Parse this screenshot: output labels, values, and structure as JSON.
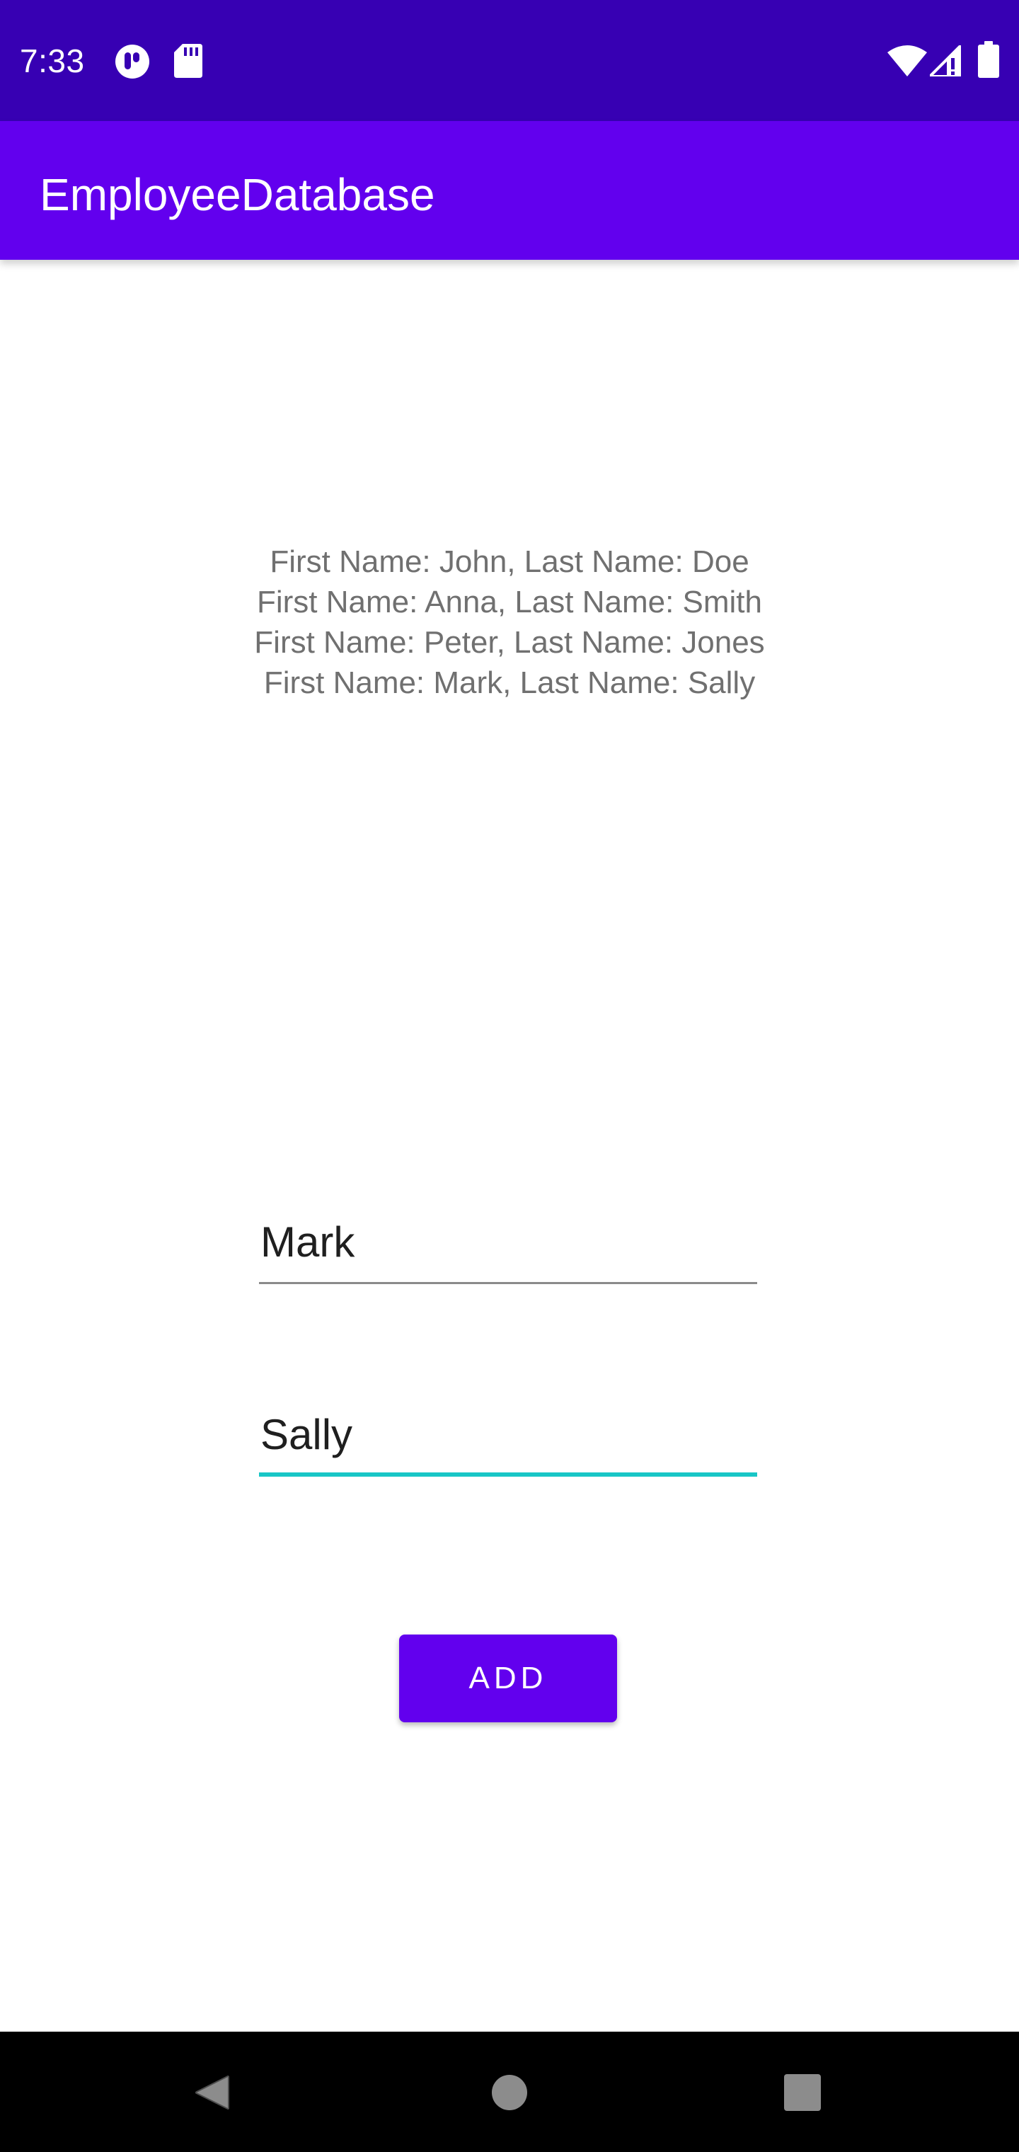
{
  "status_bar": {
    "time": "7:33",
    "background": "#3700b3",
    "icons": [
      "notification-app-icon",
      "sd-card-icon",
      "wifi-icon",
      "cell-signal-icon",
      "battery-icon"
    ]
  },
  "app_bar": {
    "title": "EmployeeDatabase",
    "background": "#6200ee"
  },
  "employees": [
    "First Name: John, Last Name: Doe",
    "First Name: Anna, Last Name: Smith",
    "First Name: Peter, Last Name: Jones",
    "First Name: Mark, Last Name: Sally"
  ],
  "form": {
    "first_name_value": "Mark",
    "last_name_value": "Sally",
    "focused_field": "last_name",
    "accent_color": "#18c6c6",
    "add_button_label": "ADD"
  },
  "nav_bar": {
    "buttons": [
      "back-icon",
      "home-icon",
      "recents-icon"
    ]
  }
}
